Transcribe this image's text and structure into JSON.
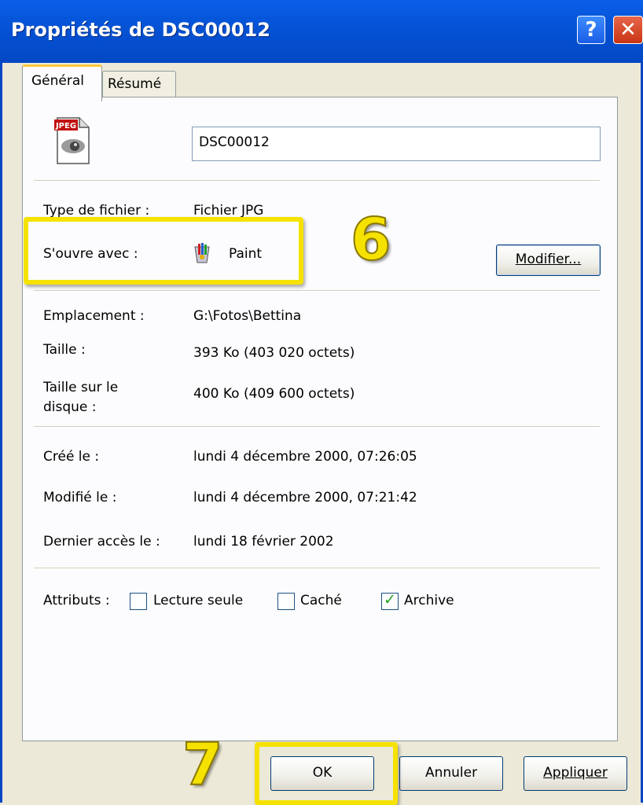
{
  "window": {
    "title": "Propriétés de DSC00012",
    "help_glyph": "?",
    "close_glyph": "✕"
  },
  "tabs": [
    {
      "label": "Général"
    },
    {
      "label": "Résumé"
    }
  ],
  "file": {
    "name": "DSC00012",
    "icon": "jpeg-file-icon",
    "icon_badge": "JPEG"
  },
  "props": {
    "type_label": "Type de fichier :",
    "type_value": "Fichier JPG",
    "opens_label": "S'ouvre avec :",
    "opens_value": "Paint",
    "opens_icon": "paint-icon",
    "modify_button": "Modifier...",
    "location_label": "Emplacement :",
    "location_value": "G:\\Fotos\\Bettina",
    "size_label": "Taille :",
    "size_value": "393 Ko (403 020 octets)",
    "disk_label_1": "Taille sur le",
    "disk_label_2": "disque :",
    "disk_value": "400 Ko (409 600 octets)",
    "created_label": "Créé le :",
    "created_value": "lundi 4 décembre 2000, 07:26:05",
    "modified_label": "Modifié le :",
    "modified_value": "lundi 4 décembre 2000, 07:21:42",
    "accessed_label": "Dernier accès le :",
    "accessed_value": "lundi 18 février 2002"
  },
  "attributes": {
    "label": "Attributs :",
    "readonly": {
      "label": "Lecture seule",
      "checked": false
    },
    "hidden": {
      "label": "Caché",
      "checked": false
    },
    "archive": {
      "label": "Archive",
      "checked": true
    }
  },
  "buttons": {
    "ok": "OK",
    "cancel": "Annuler",
    "apply": "Appliquer"
  },
  "annotations": {
    "step6": "6",
    "step7": "7",
    "highlight_color": "#f5e200"
  },
  "colors": {
    "titlebar": "#0553d6",
    "dialog_bg": "#ece9d8"
  }
}
